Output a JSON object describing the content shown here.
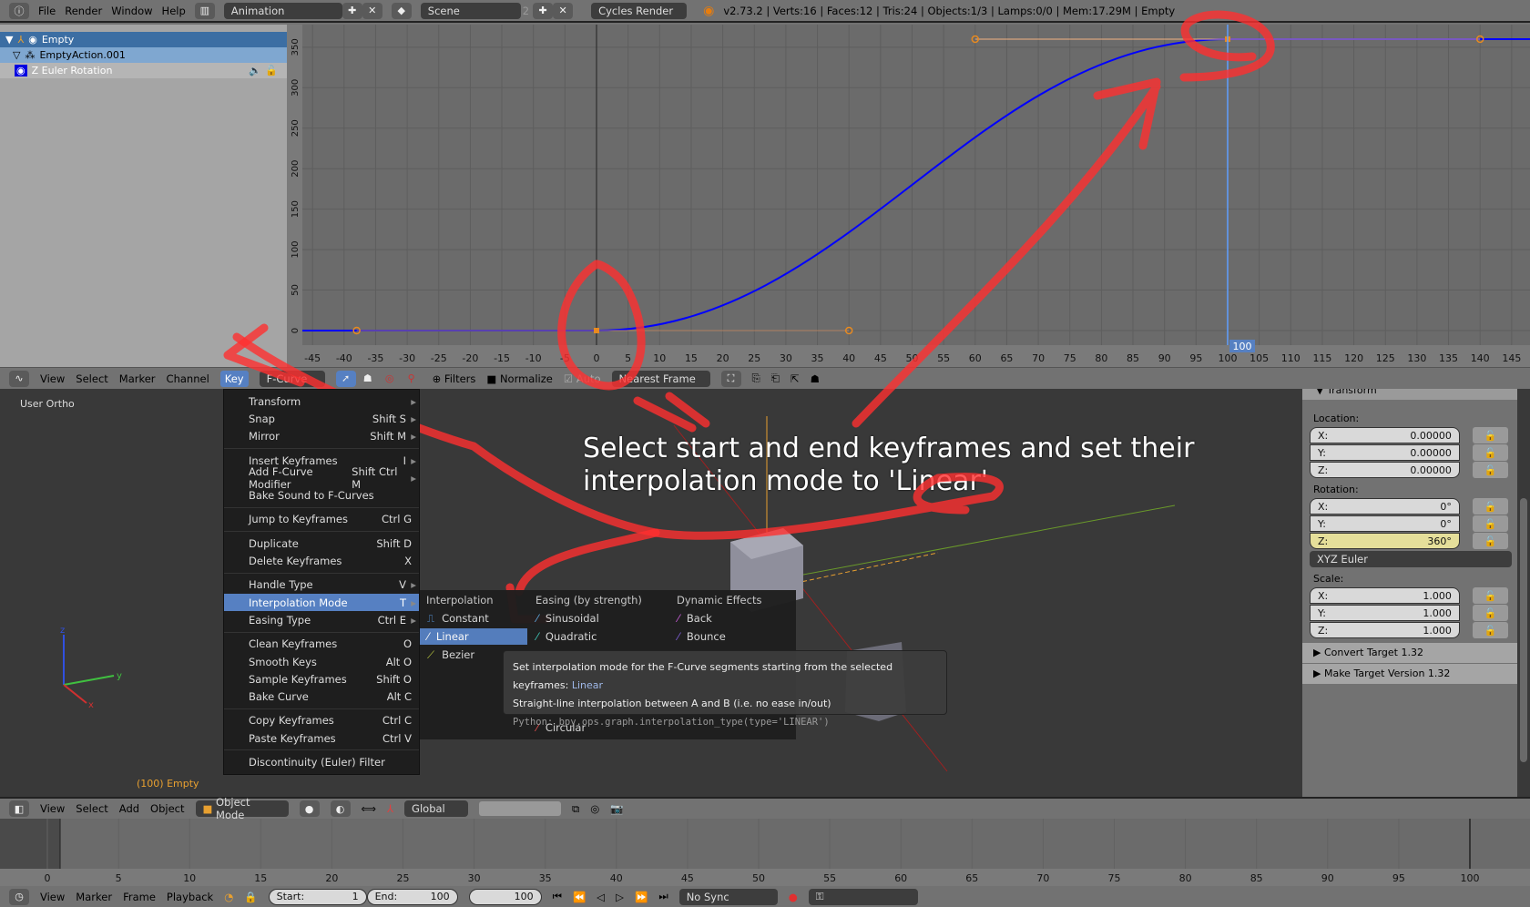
{
  "topbar": {
    "menus": [
      "File",
      "Render",
      "Window",
      "Help"
    ],
    "screen_layout": "Animation",
    "scene": "Scene",
    "scene_users": "2",
    "render_engine": "Cycles Render",
    "stats": "v2.73.2 | Verts:16 | Faces:12 | Tris:24 | Objects:1/3 | Lamps:0/0 | Mem:17.29M | Empty"
  },
  "outliner": {
    "object": "Empty",
    "action": "EmptyAction.001",
    "channel": "Z Euler Rotation"
  },
  "graph": {
    "x_ticks": [
      -45,
      -40,
      -35,
      -30,
      -25,
      -20,
      -15,
      -10,
      -5,
      0,
      5,
      10,
      15,
      20,
      25,
      30,
      35,
      40,
      45,
      50,
      55,
      60,
      65,
      70,
      75,
      80,
      85,
      90,
      95,
      100,
      105,
      110,
      115,
      120,
      125,
      130,
      135,
      140,
      145
    ],
    "y_ticks": [
      0,
      50,
      100,
      150,
      200,
      250,
      300,
      350
    ],
    "current_frame": "100",
    "keyframes": [
      {
        "frame": 0,
        "value": 0,
        "handle_left": [
          -38,
          0
        ],
        "handle_right": [
          40,
          0
        ]
      },
      {
        "frame": 100,
        "value": 360,
        "handle_left": [
          60,
          360
        ],
        "handle_right": [
          140,
          360
        ]
      }
    ],
    "curve_color": "#0000ff"
  },
  "graph_header": {
    "menus": [
      "View",
      "Select",
      "Marker",
      "Channel",
      "Key"
    ],
    "mode": "F-Curve",
    "filters": "Filters",
    "normalize": "Normalize",
    "auto": "Auto",
    "snap": "Nearest Frame"
  },
  "key_menu": {
    "groups": [
      [
        {
          "label": "Transform",
          "shortcut": "",
          "sub": true
        },
        {
          "label": "Snap",
          "shortcut": "Shift S",
          "sub": true
        },
        {
          "label": "Mirror",
          "shortcut": "Shift M",
          "sub": true
        }
      ],
      [
        {
          "label": "Insert Keyframes",
          "shortcut": "I",
          "sub": true
        },
        {
          "label": "Add F-Curve Modifier",
          "shortcut": "Shift Ctrl M",
          "sub": true
        },
        {
          "label": "Bake Sound to F-Curves",
          "shortcut": "",
          "sub": false
        }
      ],
      [
        {
          "label": "Jump to Keyframes",
          "shortcut": "Ctrl G",
          "sub": false
        }
      ],
      [
        {
          "label": "Duplicate",
          "shortcut": "Shift D",
          "sub": false
        },
        {
          "label": "Delete Keyframes",
          "shortcut": "X",
          "sub": false
        }
      ],
      [
        {
          "label": "Handle Type",
          "shortcut": "V",
          "sub": true
        },
        {
          "label": "Interpolation Mode",
          "shortcut": "T",
          "sub": true,
          "selected": true
        },
        {
          "label": "Easing Type",
          "shortcut": "Ctrl E",
          "sub": true
        }
      ],
      [
        {
          "label": "Clean Keyframes",
          "shortcut": "O",
          "sub": false
        },
        {
          "label": "Smooth Keys",
          "shortcut": "Alt O",
          "sub": false
        },
        {
          "label": "Sample Keyframes",
          "shortcut": "Shift O",
          "sub": false
        },
        {
          "label": "Bake Curve",
          "shortcut": "Alt C",
          "sub": false
        }
      ],
      [
        {
          "label": "Copy Keyframes",
          "shortcut": "Ctrl C",
          "sub": false
        },
        {
          "label": "Paste Keyframes",
          "shortcut": "Ctrl V",
          "sub": false
        }
      ],
      [
        {
          "label": "Discontinuity (Euler) Filter",
          "shortcut": "",
          "sub": false
        }
      ]
    ]
  },
  "interp_menu": {
    "headers": [
      "Interpolation",
      "Easing (by strength)",
      "Dynamic Effects"
    ],
    "interpolation": [
      "Constant",
      "Linear",
      "Bezier"
    ],
    "easing": [
      "Sinusoidal",
      "Quadratic",
      "Circular"
    ],
    "dynamic": [
      "Back",
      "Bounce"
    ],
    "selected": "Linear"
  },
  "tooltip": {
    "main": "Set interpolation mode for the F-Curve segments starting from the selected keyframes:",
    "value": "Linear",
    "desc": "Straight-line interpolation between A and B (i.e. no ease in/out)",
    "python": "Python:  bpy.ops.graph.interpolation_type(type='LINEAR')"
  },
  "viewport": {
    "view_name": "User Ortho",
    "object_label": "(100) Empty",
    "annotation_line1": "Select start and end keyframes and set their",
    "annotation_line2": "interpolation mode to 'Linear'",
    "annotation_color": "#ff2a2a"
  },
  "properties": {
    "panel": "Transform",
    "location_label": "Location:",
    "location": [
      [
        "X:",
        "0.00000"
      ],
      [
        "Y:",
        "0.00000"
      ],
      [
        "Z:",
        "0.00000"
      ]
    ],
    "rotation_label": "Rotation:",
    "rotation": [
      [
        "X:",
        "0°"
      ],
      [
        "Y:",
        "0°"
      ],
      [
        "Z:",
        "360°"
      ]
    ],
    "rotation_mode": "XYZ Euler",
    "scale_label": "Scale:",
    "scale": [
      [
        "X:",
        "1.000"
      ],
      [
        "Y:",
        "1.000"
      ],
      [
        "Z:",
        "1.000"
      ]
    ],
    "panels": [
      "Convert Target 1.32",
      "Make Target  Version 1.32"
    ]
  },
  "view3d_header": {
    "menus": [
      "View",
      "Select",
      "Add",
      "Object"
    ],
    "mode": "Object Mode",
    "orientation": "Global"
  },
  "timeline": {
    "ticks": [
      0,
      5,
      10,
      15,
      20,
      25,
      30,
      35,
      40,
      45,
      50,
      55,
      60,
      65,
      70,
      75,
      80,
      85,
      90,
      95,
      100
    ],
    "current_frame": 100
  },
  "timeline_header": {
    "menus": [
      "View",
      "Marker",
      "Frame",
      "Playback"
    ],
    "start_label": "Start:",
    "start": "1",
    "end_label": "End:",
    "end": "100",
    "current": "100",
    "sync": "No Sync"
  }
}
